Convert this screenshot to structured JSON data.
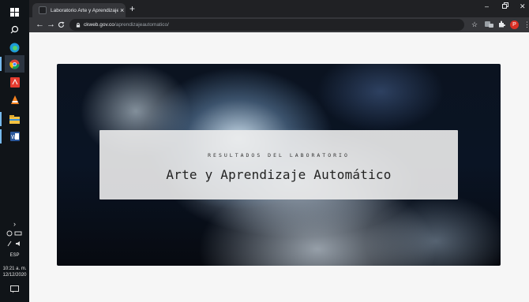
{
  "taskbar": {
    "language": "ESP",
    "time": "10:21 a. m.",
    "date": "12/12/2020"
  },
  "browser": {
    "tab": {
      "title": "Laboratorio Arte y Aprendizaje A"
    },
    "omnibox": {
      "host": "ckweb.gov.co",
      "path": "/aprendizajeautomatico/"
    }
  },
  "hero": {
    "overline": "RESULTADOS DEL LABORATORIO",
    "title": "Arte y Aprendizaje Automático"
  },
  "colors": {
    "taskbar_bg": "#101418",
    "chrome_dark": "#202124",
    "chrome_toolbar": "#35363a",
    "profile": "#d93025",
    "card_bg": "#ececec"
  }
}
